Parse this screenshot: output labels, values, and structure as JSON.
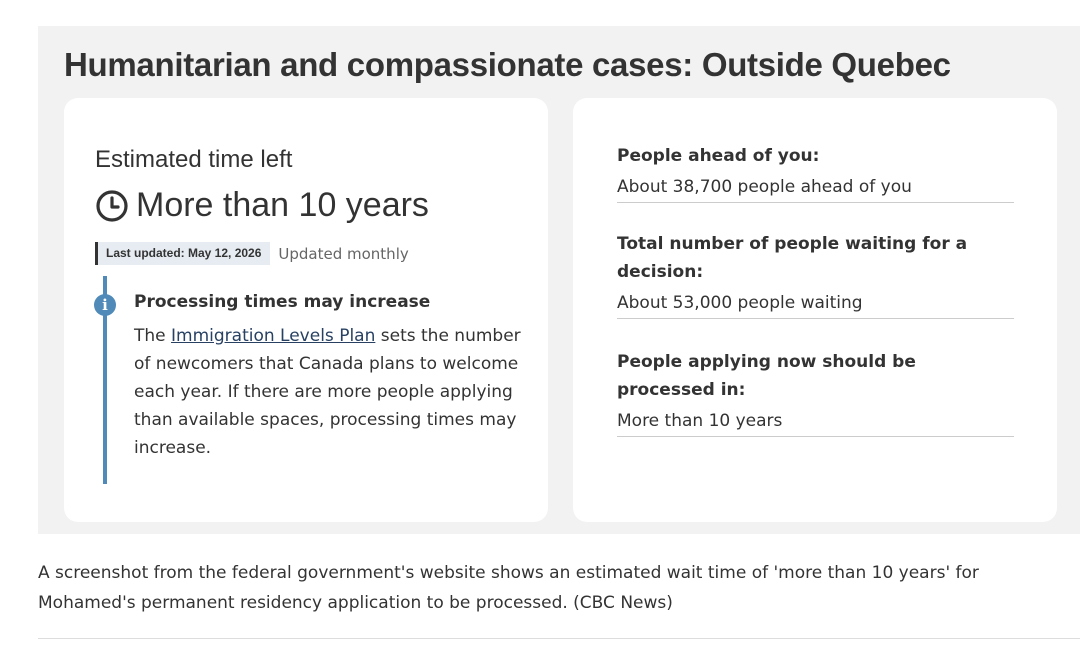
{
  "page_title": "Humanitarian and compassionate cases: Outside Quebec",
  "left_card": {
    "estimated_label": "Estimated time left",
    "estimated_value": "More than 10 years",
    "clock_icon": "clock-icon",
    "last_updated": "Last updated: May 12, 2026",
    "update_frequency": "Updated monthly",
    "alert": {
      "icon": "info-icon",
      "title": "Processing times may increase",
      "text_before_link": "The ",
      "link_text": "Immigration Levels Plan",
      "text_after_link": " sets the number of newcomers that Canada plans to welcome each year. If there are more people applying than available spaces, processing times may increase."
    }
  },
  "right_card": {
    "items": [
      {
        "label": "People ahead of you:",
        "value": "About 38,700 people ahead of you"
      },
      {
        "label": "Total number of people waiting for a decision:",
        "value": "About 53,000 people waiting"
      },
      {
        "label": "People applying now should be processed in:",
        "value": "More than 10 years"
      }
    ]
  },
  "caption": "A screenshot from the federal government's website shows an estimated wait time of 'more than 10 years' for Mohamed's permanent residency application to be processed. (CBC News)",
  "colors": {
    "panel_background": "#f2f2f2",
    "card_background": "#ffffff",
    "accent_blue": "#4f8ab9",
    "badge_background": "#e6ecf1",
    "link": "#284162",
    "text": "#333333"
  }
}
